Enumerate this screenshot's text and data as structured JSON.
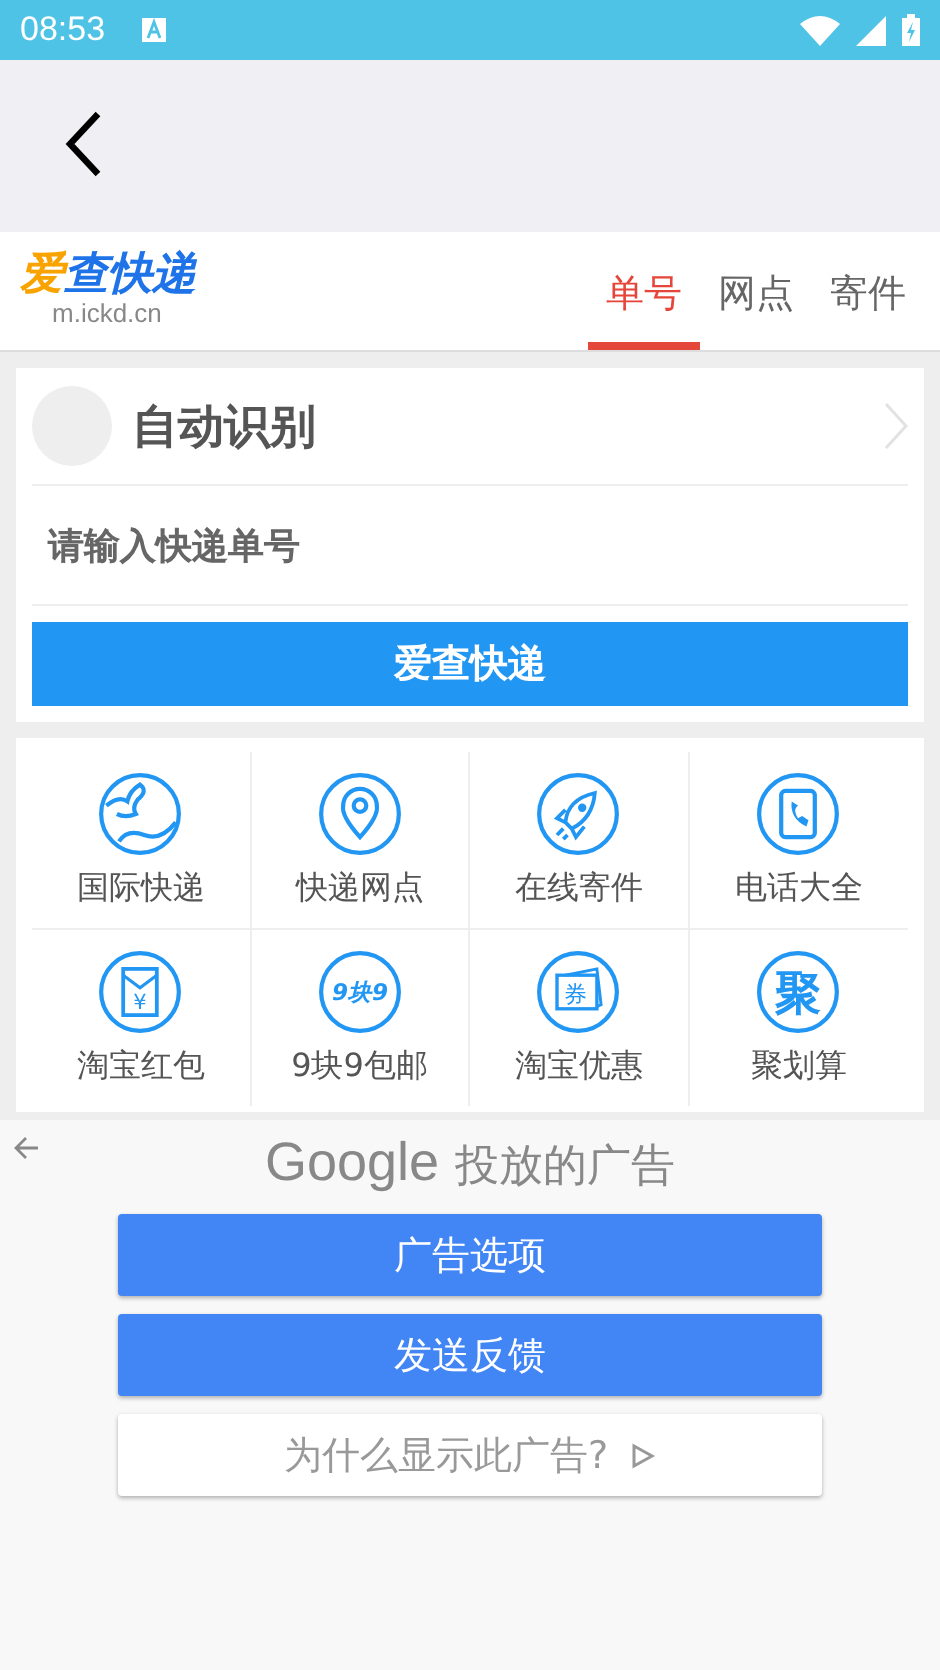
{
  "status_bar": {
    "time": "08:53"
  },
  "header": {
    "logo": {
      "accent": "爱",
      "main": "查快递",
      "domain": "m.ickd.cn"
    },
    "tabs": [
      {
        "label": "单号",
        "selected": true
      },
      {
        "label": "网点",
        "selected": false
      },
      {
        "label": "寄件",
        "selected": false
      }
    ]
  },
  "query": {
    "title": "自动识别",
    "placeholder": "请输入快递单号",
    "button": "爱查快递"
  },
  "services": [
    {
      "label": "国际快递",
      "kind": "globe"
    },
    {
      "label": "快递网点",
      "kind": "pin"
    },
    {
      "label": "在线寄件",
      "kind": "rocket"
    },
    {
      "label": "电话大全",
      "kind": "phonebook"
    },
    {
      "label": "淘宝红包",
      "kind": "envelope",
      "icon_text": "¥"
    },
    {
      "label": "9块9包邮",
      "kind": "text",
      "icon_text": "9块9"
    },
    {
      "label": "淘宝优惠",
      "kind": "ticket",
      "icon_text": "券"
    },
    {
      "label": "聚划算",
      "kind": "bigtext",
      "icon_text": "聚"
    }
  ],
  "ad": {
    "brand": "Google",
    "title": "投放的广告",
    "buttons": [
      {
        "label": "广告选项",
        "kind": "primary"
      },
      {
        "label": "发送反馈",
        "kind": "primary"
      },
      {
        "label": "为什么显示此广告?",
        "kind": "plain"
      }
    ]
  }
}
